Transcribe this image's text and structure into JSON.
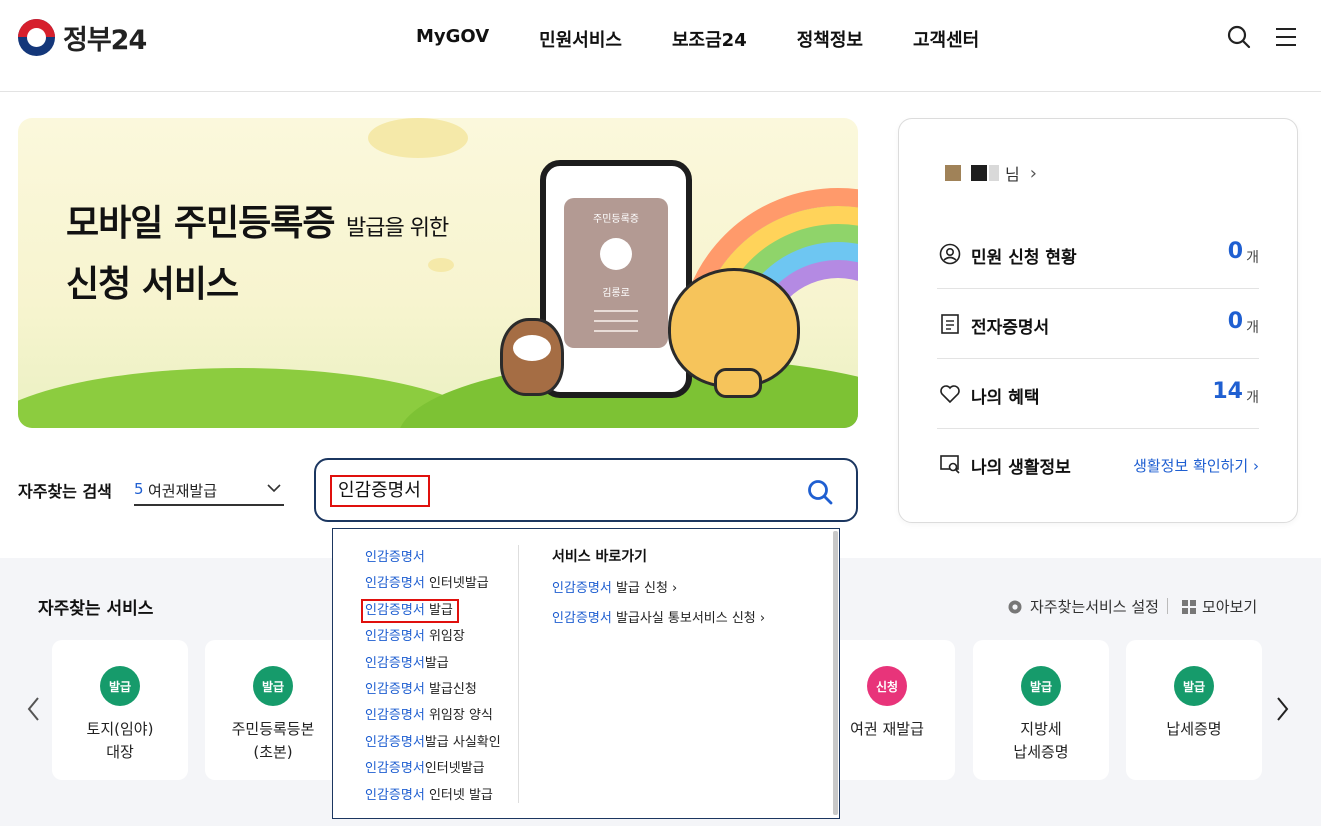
{
  "header": {
    "logo_text": "정부24",
    "nav": [
      "MyGOV",
      "민원서비스",
      "보조금24",
      "정책정보",
      "고객센터"
    ]
  },
  "banner": {
    "title_line1": "모바일 주민등록증",
    "title_line1_small": "발급을 위한",
    "title_line2": "신청 서비스",
    "card_title": "주민등록증",
    "card_name": "김롱로"
  },
  "quick_search": {
    "label": "자주찾는 검색",
    "rank": "5",
    "value": "여권재발급"
  },
  "search": {
    "value": "인감증명서"
  },
  "side": {
    "user_suffix": "님",
    "stats": [
      {
        "label": "민원 신청 현황",
        "count": "0",
        "unit": "개"
      },
      {
        "label": "전자증명서",
        "count": "0",
        "unit": "개"
      },
      {
        "label": "나의 혜택",
        "count": "14",
        "unit": "개"
      }
    ],
    "life_label": "나의 생활정보",
    "life_link": "생활정보 확인하기 ›"
  },
  "favorites": {
    "title": "자주찾는 서비스",
    "settings": "자주찾는서비스 설정",
    "view_all": "모아보기",
    "cards": [
      {
        "badge": "발급",
        "label": "토지(임야)\n대장"
      },
      {
        "badge": "발급",
        "label": "주민등록등본\n(초본)"
      },
      {
        "badge": "신청",
        "label": "여권 재발급"
      },
      {
        "badge": "발급",
        "label": "지방세\n납세증명"
      },
      {
        "badge": "발급",
        "label": "납세증명"
      }
    ]
  },
  "autocomplete": {
    "items": [
      {
        "hl": "인감증명서",
        "rest": ""
      },
      {
        "hl": "인감증명서",
        "rest": " 인터넷발급"
      },
      {
        "hl": "인감증명서",
        "rest": " 발급"
      },
      {
        "hl": "인감증명서",
        "rest": " 위임장"
      },
      {
        "hl": "인감증명서",
        "rest": "발급"
      },
      {
        "hl": "인감증명서",
        "rest": " 발급신청"
      },
      {
        "hl": "인감증명서",
        "rest": " 위임장 양식"
      },
      {
        "hl": "인감증명서",
        "rest": "발급 사실확인"
      },
      {
        "hl": "인감증명서",
        "rest": "인터넷발급"
      },
      {
        "hl": "인감증명서",
        "rest": " 인터넷 발급"
      }
    ],
    "shortcut_title": "서비스 바로가기",
    "shortcuts": [
      {
        "hl": "인감증명서",
        "rest": " 발급 신청  ›"
      },
      {
        "hl": "인감증명서",
        "rest": " 발급사실 통보서비스 신청  ›"
      }
    ]
  },
  "colors": {
    "accent": "#1f5fd1",
    "badge_green": "#169b6b",
    "badge_pink": "#e8347a",
    "highlight_box": "#e0100d"
  }
}
